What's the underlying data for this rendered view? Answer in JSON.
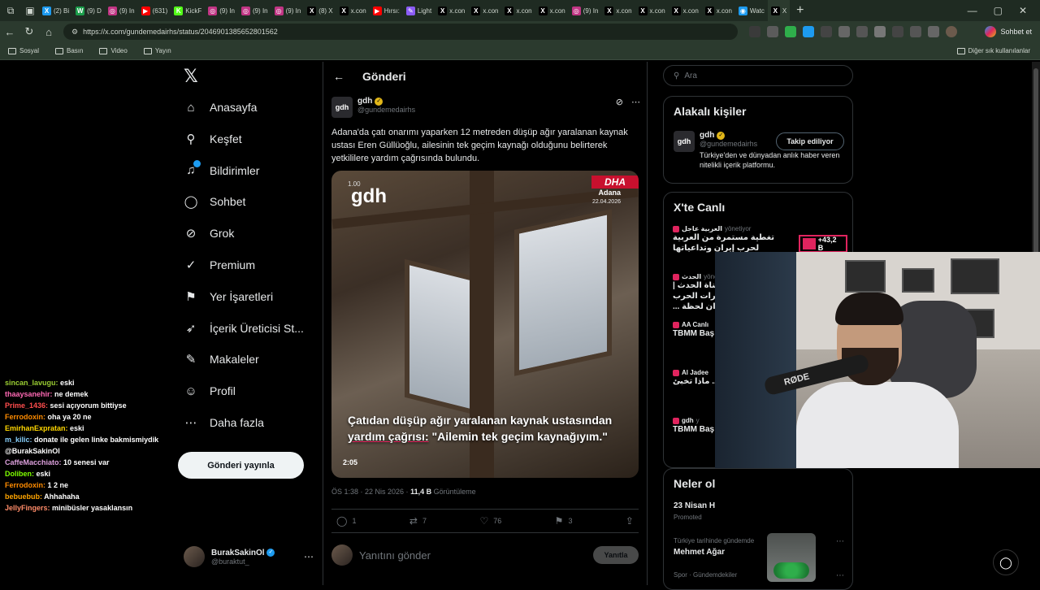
{
  "browser": {
    "tabs": [
      {
        "label": "(2) Bi",
        "color": "#1d9bf0",
        "glyph": "X"
      },
      {
        "label": "(9) D",
        "color": "#1b9e4b",
        "glyph": "W"
      },
      {
        "label": "(9) In",
        "color": "#c13584",
        "glyph": "◎"
      },
      {
        "label": "(631)",
        "color": "#ff0000",
        "glyph": "▶"
      },
      {
        "label": "KickF",
        "color": "#53fc18",
        "glyph": "K"
      },
      {
        "label": "(9) In",
        "color": "#c13584",
        "glyph": "◎"
      },
      {
        "label": "(9) In",
        "color": "#c13584",
        "glyph": "◎"
      },
      {
        "label": "(9) In",
        "color": "#c13584",
        "glyph": "◎"
      },
      {
        "label": "(8) X",
        "color": "#000000",
        "glyph": "X"
      },
      {
        "label": "x.con",
        "color": "#000000",
        "glyph": "X"
      },
      {
        "label": "Hırsı:",
        "color": "#ff0000",
        "glyph": "▶"
      },
      {
        "label": "Light",
        "color": "#8b5cf6",
        "glyph": "✎"
      },
      {
        "label": "x.con",
        "color": "#000000",
        "glyph": "X"
      },
      {
        "label": "x.con",
        "color": "#000000",
        "glyph": "X"
      },
      {
        "label": "x.con",
        "color": "#000000",
        "glyph": "X"
      },
      {
        "label": "x.con",
        "color": "#000000",
        "glyph": "X"
      },
      {
        "label": "(9) In",
        "color": "#c13584",
        "glyph": "◎"
      },
      {
        "label": "x.con",
        "color": "#000000",
        "glyph": "X"
      },
      {
        "label": "x.con",
        "color": "#000000",
        "glyph": "X"
      },
      {
        "label": "x.con",
        "color": "#000000",
        "glyph": "X"
      },
      {
        "label": "x.con",
        "color": "#000000",
        "glyph": "X"
      },
      {
        "label": "Watc",
        "color": "#1d9bf0",
        "glyph": "◉"
      },
      {
        "label": "X",
        "color": "#000000",
        "glyph": "X"
      }
    ],
    "url": "https://x.com/gundemedairhs/status/2046901385652801562",
    "chat_button": "Sohbet et",
    "bookmarks": [
      "Sosyal",
      "Basın",
      "Video",
      "Yayın"
    ],
    "bookmarks_right": "Diğer sık kullanılanlar"
  },
  "nav": {
    "items": [
      {
        "label": "Anasayfa",
        "icon": "home-icon",
        "glyph": "⌂"
      },
      {
        "label": "Keşfet",
        "icon": "search-icon",
        "glyph": "⚲"
      },
      {
        "label": "Bildirimler",
        "icon": "bell-icon",
        "glyph": "♫"
      },
      {
        "label": "Sohbet",
        "icon": "chat-icon",
        "glyph": "◯"
      },
      {
        "label": "Grok",
        "icon": "grok-icon",
        "glyph": "⊘"
      },
      {
        "label": "Premium",
        "icon": "premium-icon",
        "glyph": "✓"
      },
      {
        "label": "Yer İşaretleri",
        "icon": "bookmark-icon",
        "glyph": "⚑"
      },
      {
        "label": "İçerik Üreticisi St...",
        "icon": "rocket-icon",
        "glyph": "➶"
      },
      {
        "label": "Makaleler",
        "icon": "article-icon",
        "glyph": "✎"
      },
      {
        "label": "Profil",
        "icon": "profile-icon",
        "glyph": "☺"
      },
      {
        "label": "Daha fazla",
        "icon": "more-icon",
        "glyph": "⋯"
      }
    ],
    "post_button": "Gönderi yayınla",
    "account": {
      "name": "BurakSakinOl",
      "handle": "@buraktut_"
    }
  },
  "main": {
    "header": "Gönderi",
    "tweet": {
      "name": "gdh",
      "handle": "@gundemedairhs",
      "text": "Adana'da çatı onarımı yaparken 12 metreden düşüp ağır yaralanan kaynak ustası Eren Güllüoğlu, ailesinin tek geçim kaynağı olduğunu belirterek yetkililere yardım çağrısında bulundu.",
      "video": {
        "brand": "gdh",
        "brand_small": "1.00",
        "agency": "DHA",
        "location": "Adana",
        "date": "22.04.2026",
        "caption_a": "Çatıdan düşüp ağır yaralanan kaynak ustasından",
        "caption_b": "yardım çağrısı:",
        "caption_c": " \"Ailemin tek geçim kaynağıyım.\"",
        "duration": "2:05"
      },
      "time": "ÖS 1:38 · 22 Nis 2026 · ",
      "views": "11,4 B",
      "views_label": " Görüntüleme",
      "stats": {
        "replies": "1",
        "reposts": "7",
        "likes": "76",
        "bookmarks": "3"
      }
    },
    "reply_placeholder": "Yanıtını gönder",
    "reply_button": "Yanıtla"
  },
  "right": {
    "search_placeholder": "Ara",
    "related_title": "Alakalı kişiler",
    "related": {
      "name": "gdh",
      "handle": "@gundemedairhs",
      "bio": "Türkiye'den ve dünyadan anlık haber veren nitelikli içerik platformu.",
      "button": "Takip ediliyor"
    },
    "live_title": "X'te Canlı",
    "live": [
      {
        "source": "العربية عاجل",
        "status": "yönetiyor",
        "text": "تغطية مستمرة من العربية لحرب إيران وتداعياتها",
        "count": "+43,2 B"
      },
      {
        "source": "الحدث",
        "status": "yönetiyor",
        "text": "مباشر من قناة الحدث | تغطية خاصة لتطورات الحرب على إيران لحظة ...",
        "count": "+993"
      },
      {
        "source": "AA Canlı",
        "status": "",
        "text": "TBMM Baş Kurtulmuş",
        "count": ""
      },
      {
        "source": "Al Jadee",
        "status": "",
        "text": "مبين واجتماع ... ماذا تخبئ",
        "count": ""
      },
      {
        "source": "gdh",
        "status": "y",
        "text": "TBMM Baş Kurtulmuş",
        "count": ""
      }
    ],
    "trends_title": "Neler ol",
    "trend1": "23 Nisan H",
    "trend1_meta": "Promoted",
    "trend2_meta": "Türkiye tarihinde gündemde",
    "trend2": "Mehmet Ağar",
    "trend3_meta": "Spor · Gündemdekiler"
  },
  "chat": [
    {
      "user": "sincan_lavugu:",
      "msg": " eski",
      "color": "#9acd32"
    },
    {
      "user": "thaaysanehir:",
      "msg": " ne demek",
      "color": "#ff69b4"
    },
    {
      "user": "Prime_1436:",
      "msg": " sesi açıyorum bittiyse",
      "color": "#ff4d4d"
    },
    {
      "user": "Ferrodoxin:",
      "msg": " oha ya 20 ne",
      "color": "#ff8c00"
    },
    {
      "user": "EmirhanExpratan:",
      "msg": " eski",
      "color": "#ffd700"
    },
    {
      "user": "m_kilic:",
      "msg": " donate ile gelen linke bakmismiydik @BurakSakinOl",
      "color": "#87cefa"
    },
    {
      "user": "CaffeMacchiato:",
      "msg": " 10 senesi var",
      "color": "#dda0dd"
    },
    {
      "user": "Doliben:",
      "msg": " eski",
      "color": "#7fff00"
    },
    {
      "user": "Ferrodoxin:",
      "msg": " 1 2 ne",
      "color": "#ff8c00"
    },
    {
      "user": "bebuebub:",
      "msg": " Ahhahaha",
      "color": "#ffa500"
    },
    {
      "user": "JellyFingers:",
      "msg": " minibüsler yasaklansın",
      "color": "#ff8c69"
    }
  ],
  "webcam": {
    "mic_label": "RØDE"
  },
  "colors": {
    "accent": "#1d9bf0",
    "gold": "#e2b719",
    "live_border": "#e0245e"
  }
}
